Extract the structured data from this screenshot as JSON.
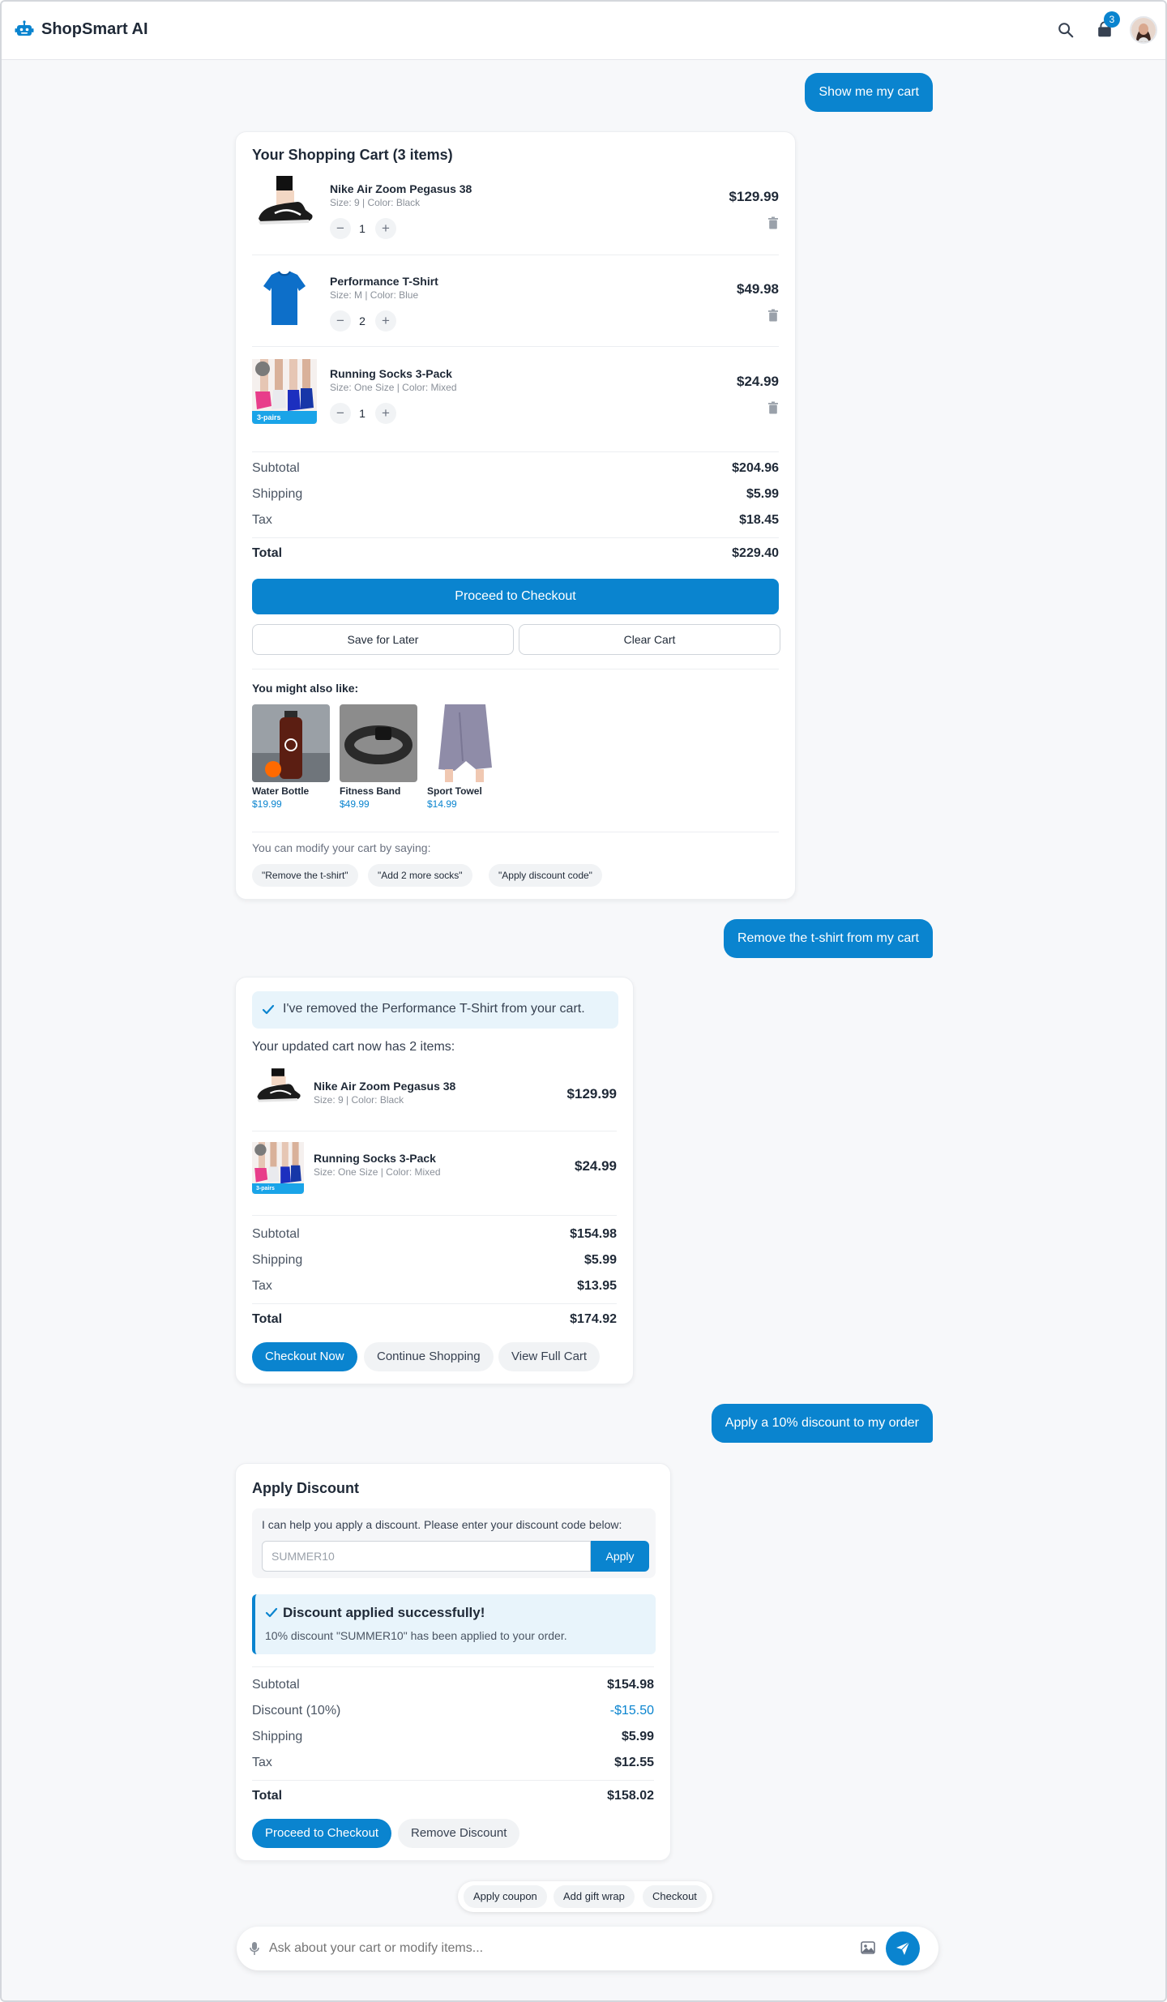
{
  "app": {
    "name": "ShopSmart AI",
    "cart_count": "3"
  },
  "colors": {
    "accent": "#0a84cf",
    "background": "#f7f8fa",
    "notice_bg": "#e8f4fb"
  },
  "messages": {
    "user1": "Show me my cart",
    "user2": "Remove the t-shirt from my cart",
    "user3": "Apply a 10% discount to my order"
  },
  "cart": {
    "title": "Your Shopping Cart (3 items)",
    "items": [
      {
        "name": "Nike Air Zoom Pegasus 38",
        "meta": "Size: 9 | Color: Black",
        "qty": "1",
        "price": "$129.99"
      },
      {
        "name": "Performance T-Shirt",
        "meta": "Size: M | Color: Blue",
        "qty": "2",
        "price": "$49.98"
      },
      {
        "name": "Running Socks 3-Pack",
        "meta": "Size: One Size | Color: Mixed",
        "qty": "1",
        "price": "$24.99",
        "tag": "3-pairs"
      }
    ],
    "summary": {
      "subtotal_label": "Subtotal",
      "subtotal": "$204.96",
      "shipping_label": "Shipping",
      "shipping": "$5.99",
      "tax_label": "Tax",
      "tax": "$18.45",
      "total_label": "Total",
      "total": "$229.40"
    },
    "checkout_label": "Proceed to Checkout",
    "save_label": "Save for Later",
    "clear_label": "Clear Cart",
    "recs_label": "You might also like:",
    "recs": [
      {
        "name": "Water Bottle",
        "price": "$19.99"
      },
      {
        "name": "Fitness Band",
        "price": "$49.99"
      },
      {
        "name": "Sport Towel",
        "price": "$14.99"
      }
    ],
    "hint": "You can modify your cart by saying:",
    "suggestions": [
      "\"Remove the t-shirt\"",
      "\"Add 2 more socks\"",
      "\"Apply discount code\""
    ]
  },
  "updated": {
    "notice": "I've removed the Performance T-Shirt from your cart.",
    "intro": "Your updated cart now has 2 items:",
    "items": [
      {
        "name": "Nike Air Zoom Pegasus 38",
        "meta": "Size: 9 | Color: Black",
        "price": "$129.99"
      },
      {
        "name": "Running Socks 3-Pack",
        "meta": "Size: One Size | Color: Mixed",
        "price": "$24.99",
        "tag": "3-pairs"
      }
    ],
    "summary": {
      "subtotal_label": "Subtotal",
      "subtotal": "$154.98",
      "shipping_label": "Shipping",
      "shipping": "$5.99",
      "tax_label": "Tax",
      "tax": "$13.95",
      "total_label": "Total",
      "total": "$174.92"
    },
    "actions": {
      "checkout": "Checkout Now",
      "continue": "Continue Shopping",
      "view": "View Full Cart"
    }
  },
  "discount": {
    "title": "Apply Discount",
    "prompt": "I can help you apply a discount. Please enter your discount code below:",
    "code_value": "SUMMER10",
    "apply_label": "Apply",
    "success_title": "Discount applied successfully!",
    "success_desc": "10% discount \"SUMMER10\" has been applied to your order.",
    "summary": {
      "subtotal_label": "Subtotal",
      "subtotal": "$154.98",
      "discount_label": "Discount (10%)",
      "discount": "-$15.50",
      "shipping_label": "Shipping",
      "shipping": "$5.99",
      "tax_label": "Tax",
      "tax": "$12.55",
      "total_label": "Total",
      "total": "$158.02"
    },
    "checkout_label": "Proceed to Checkout",
    "remove_label": "Remove Discount"
  },
  "quick_actions": [
    "Apply coupon",
    "Add gift wrap",
    "Checkout"
  ],
  "composer": {
    "placeholder": "Ask about your cart or modify items..."
  }
}
